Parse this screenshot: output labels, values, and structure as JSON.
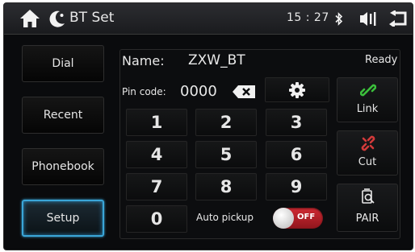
{
  "topbar": {
    "title": "BT Set",
    "time": "15 : 27",
    "icons": [
      "home-icon",
      "moon-icon",
      "bluetooth-icon",
      "volume-icon",
      "back-icon"
    ]
  },
  "sidebar": {
    "items": [
      {
        "label": "Dial"
      },
      {
        "label": "Recent"
      },
      {
        "label": "Phonebook"
      },
      {
        "label": "Setup"
      }
    ],
    "active": "Setup"
  },
  "info": {
    "name_label": "Name:",
    "name_value": "ZXW_BT",
    "status": "Ready",
    "pin_label": "Pin code:",
    "pin_value": "0000"
  },
  "keypad": {
    "keys": [
      "1",
      "2",
      "3",
      "4",
      "5",
      "6",
      "7",
      "8",
      "9",
      "0"
    ]
  },
  "auto_pickup": {
    "label": "Auto pickup",
    "state": "OFF"
  },
  "actions": {
    "link": "Link",
    "cut": "Cut",
    "pair": "PAIR"
  },
  "colors": {
    "active_border": "#3aa6d8",
    "link_icon": "#3bbf3b",
    "cut_icon": "#d23a3a",
    "toggle_off": "#b8232b"
  }
}
